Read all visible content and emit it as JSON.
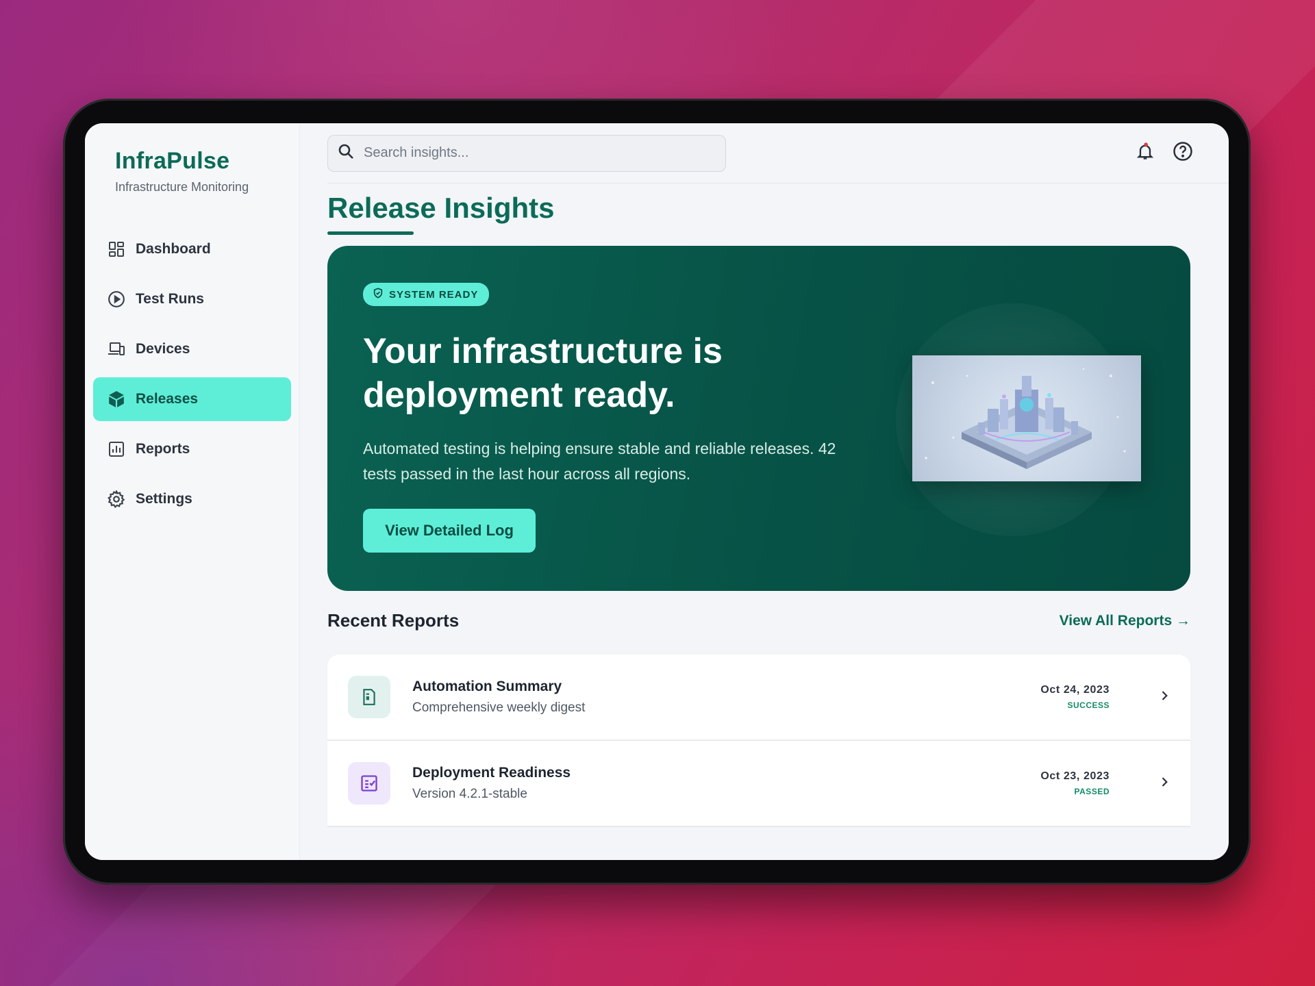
{
  "app": {
    "name": "InfraPulse",
    "subtitle": "Infrastructure Monitoring"
  },
  "sidebar": {
    "items": [
      {
        "label": "Dashboard",
        "icon": "dashboard-grid-icon",
        "active": false
      },
      {
        "label": "Test Runs",
        "icon": "play-circle-icon",
        "active": false
      },
      {
        "label": "Devices",
        "icon": "devices-icon",
        "active": true
      },
      {
        "label": "Releases",
        "icon": "package-icon",
        "active": true
      },
      {
        "label": "Reports",
        "icon": "bar-chart-icon",
        "active": false
      },
      {
        "label": "Settings",
        "icon": "gear-icon",
        "active": false
      }
    ]
  },
  "topbar": {
    "search_placeholder": "Search insights...",
    "icons": [
      "bell-icon",
      "help-circle-icon"
    ]
  },
  "page": {
    "title": "Release Insights"
  },
  "hero": {
    "badge": "SYSTEM READY",
    "title": "Your infrastructure is deployment ready.",
    "description": "Automated testing is helping ensure stable and reliable releases. 42 tests passed in the last hour across all regions.",
    "button_label": "View Detailed Log"
  },
  "reports": {
    "title": "Recent Reports",
    "view_all": "View All Reports →",
    "items": [
      {
        "name": "Automation Summary",
        "subtitle": "Comprehensive weekly digest",
        "date": "Oct 24, 2023",
        "status": "SUCCESS"
      },
      {
        "name": "Deployment Readiness",
        "subtitle": "Version 4.2.1-stable",
        "date": "Oct 23, 2023",
        "status": "PASSED"
      }
    ]
  },
  "colors": {
    "brand": "#0b6b58",
    "accent": "#5eeed8",
    "hero_bg": "#075246",
    "status_green": "#138a68"
  }
}
